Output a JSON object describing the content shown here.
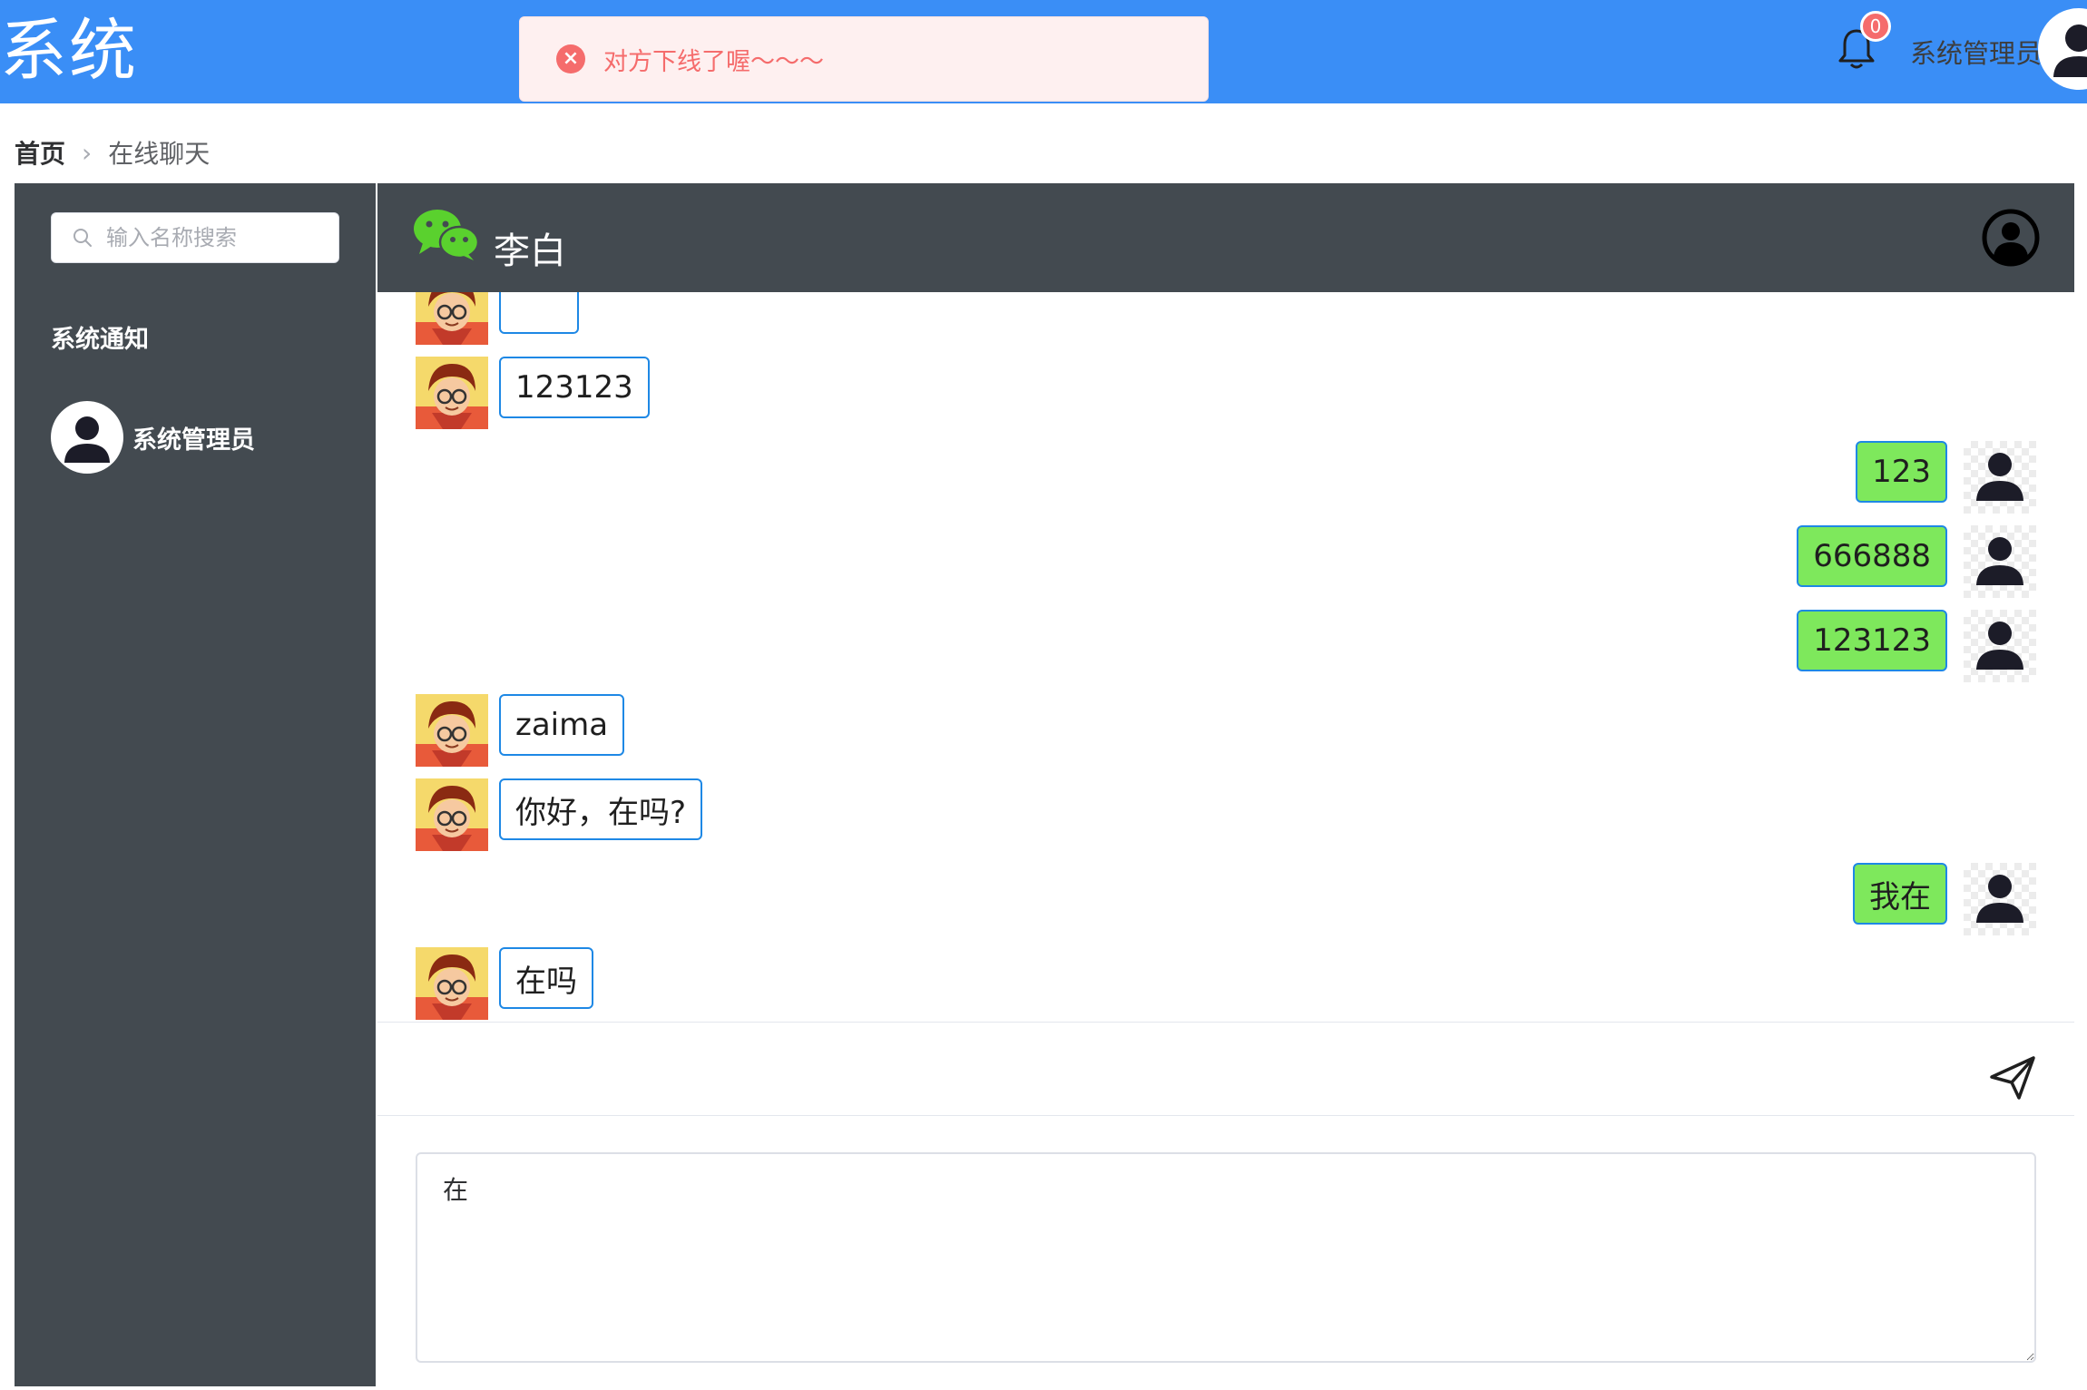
{
  "app": {
    "title": "系统"
  },
  "toast": {
    "message": "对方下线了喔～～～",
    "icon": "error-circle-icon",
    "color": "#f56c6c"
  },
  "header": {
    "notification_count": "0",
    "user_name": "系统管理员",
    "bar_color": "#3a8ef6"
  },
  "breadcrumb": {
    "home": "首页",
    "current": "在线聊天"
  },
  "sidebar": {
    "search_placeholder": "输入名称搜索",
    "notice_title": "系统通知",
    "contacts": [
      {
        "name": "系统管理员"
      }
    ]
  },
  "chat": {
    "peer_name": "李白",
    "messages": [
      {
        "side": "left",
        "text": ""
      },
      {
        "side": "left",
        "text": "123123"
      },
      {
        "side": "right",
        "text": "123"
      },
      {
        "side": "right",
        "text": "666888"
      },
      {
        "side": "right",
        "text": "123123"
      },
      {
        "side": "left",
        "text": "zaima"
      },
      {
        "side": "left",
        "text": "你好，在吗?"
      },
      {
        "side": "right",
        "text": "我在"
      },
      {
        "side": "left",
        "text": "在吗"
      }
    ],
    "compose_value": "在",
    "colors": {
      "panel": "#434a50",
      "own_bubble": "#7ee85c",
      "bubble_border": "#1e88e5"
    }
  }
}
